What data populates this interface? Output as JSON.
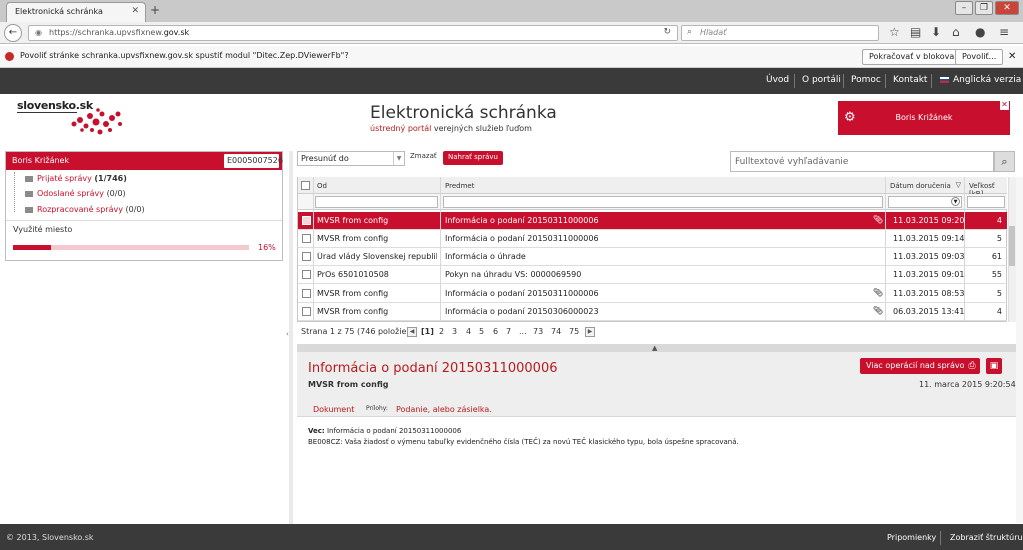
{
  "browser": {
    "tab_title": "Elektronická schránka",
    "url_prefix": "https://schranka.upvsfixnew.",
    "url_domain": "gov.sk",
    "search_placeholder": "Hľadať",
    "notification": "Povoliť stránke schranka.upvsfixnew.gov.sk spustiť modul \"Ditec.Zep.DViewerFb\"?",
    "btn_block": "Pokračovať v blokovaní",
    "btn_allow": "Povoliť..."
  },
  "topnav": [
    "Úvod",
    "O portáli",
    "Pomoc",
    "Kontakt",
    "Anglická verzia"
  ],
  "brand": {
    "logo": "slovensko.sk",
    "title": "Elektronická schránka",
    "sub_red": "ústredný portál",
    "sub_rest": " verejných služieb ľuďom"
  },
  "user": {
    "name": "Boris Križánek"
  },
  "sidebar": {
    "owner": "Boris Križánek",
    "account": "E0005007526",
    "folders": [
      {
        "name": "Prijaté správy",
        "count": "(1/746)"
      },
      {
        "name": "Odoslané správy",
        "count": "(0/0)"
      },
      {
        "name": "Rozpracované správy",
        "count": "(0/0)"
      }
    ],
    "usage_label": "Využité miesto",
    "usage_pct_text": "16%",
    "usage_fraction": 0.16
  },
  "toolbar": {
    "move_to": "Presunúť do",
    "delete": "Zmazať",
    "upload": "Nahrať správu",
    "fulltext_placeholder": "Fulltextové vyhľadávanie"
  },
  "grid": {
    "headers": {
      "from": "Od",
      "subject": "Predmet",
      "date": "Dátum doručenia",
      "size": "Veľkosť [kB]"
    },
    "rows": [
      {
        "from": "MVSR from config",
        "subject": "Informácia o podaní 20150311000006",
        "date": "11.03.2015 09:20",
        "size": "4",
        "att": true
      },
      {
        "from": "MVSR from config",
        "subject": "Informácia o podaní 20150311000006",
        "date": "11.03.2015 09:14",
        "size": "5",
        "att": false
      },
      {
        "from": "Úrad vlády Slovenskej republiky...",
        "subject": "Informácia o úhrade",
        "date": "11.03.2015 09:03",
        "size": "61",
        "att": false
      },
      {
        "from": "PrOs 6501010508",
        "subject": "Pokyn na úhradu VS: 0000069590",
        "date": "11.03.2015 09:01",
        "size": "55",
        "att": false
      },
      {
        "from": "MVSR from config",
        "subject": "Informácia o podaní 20150311000006",
        "date": "11.03.2015 08:53",
        "size": "5",
        "att": true
      },
      {
        "from": "MVSR from config",
        "subject": "Informácia o podaní 20150306000023",
        "date": "06.03.2015 13:41",
        "size": "4",
        "att": true
      }
    ]
  },
  "pager": {
    "summary": "Strana 1 z 75 (746 položiek)",
    "pages": [
      "[1]",
      "2",
      "3",
      "4",
      "5",
      "6",
      "7",
      "...",
      "73",
      "74",
      "75"
    ]
  },
  "detail": {
    "title": "Informácia o podaní 20150311000006",
    "from": "MVSR from config",
    "date": "11. marca 2015 9:20:54",
    "more_ops": "Viac operácií nad správou",
    "tab_doc": "Dokument",
    "att_label": "Prílohy:",
    "att_value": "Podanie, alebo zásielka.",
    "subject_label": "Vec:",
    "subject_value": " Informácia o podaní 20150311000006",
    "body": "BE008CZ: Vaša žiadosť o výmenu tabuľky evidenčného čísla (TEČ) za novú TEČ klasického typu, bola úspešne spracovaná."
  },
  "footer": {
    "copyright": "© 2013, Slovensko.sk",
    "feedback": "Pripomienky",
    "structure": "Zobraziť štruktúru"
  },
  "colors": {
    "accent": "#c8102e",
    "dark": "#3a3a3a"
  }
}
